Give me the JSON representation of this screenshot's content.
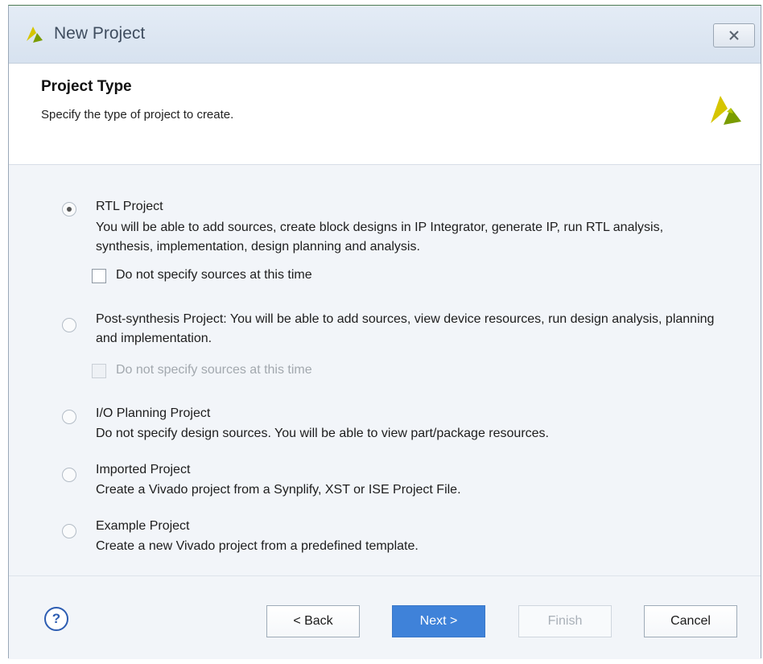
{
  "window": {
    "title": "New Project",
    "close_icon": "close-icon"
  },
  "header": {
    "title": "Project Type",
    "subtitle": "Specify the type of project to create.",
    "logo_icon": "vivado-logo-icon"
  },
  "options": [
    {
      "title": "RTL Project",
      "description": "You will be able to add sources, create block designs in IP Integrator, generate IP, run RTL analysis, synthesis, implementation, design planning and analysis.",
      "selected": true,
      "checkbox": {
        "label": "Do not specify sources at this time",
        "checked": false,
        "enabled": true
      }
    },
    {
      "title": "Post-synthesis Project: You will be able to add sources, view device resources, run design analysis, planning and implementation.",
      "selected": false,
      "checkbox": {
        "label": "Do not specify sources at this time",
        "checked": false,
        "enabled": false
      }
    },
    {
      "title": "I/O Planning Project",
      "description": "Do not specify design sources. You will be able to view part/package resources.",
      "selected": false
    },
    {
      "title": "Imported Project",
      "description": "Create a Vivado project from a Synplify, XST or ISE Project File.",
      "selected": false
    },
    {
      "title": "Example Project",
      "description": "Create a new Vivado project from a predefined template.",
      "selected": false
    }
  ],
  "footer": {
    "help_label": "?",
    "back_label": "< Back",
    "next_label": "Next >",
    "finish_label": "Finish",
    "cancel_label": "Cancel"
  },
  "colors": {
    "accent": "#3f82d9",
    "title_bar": "#dfe8f3",
    "logo_yellow": "#d6c500",
    "logo_green": "#7a9c00"
  }
}
